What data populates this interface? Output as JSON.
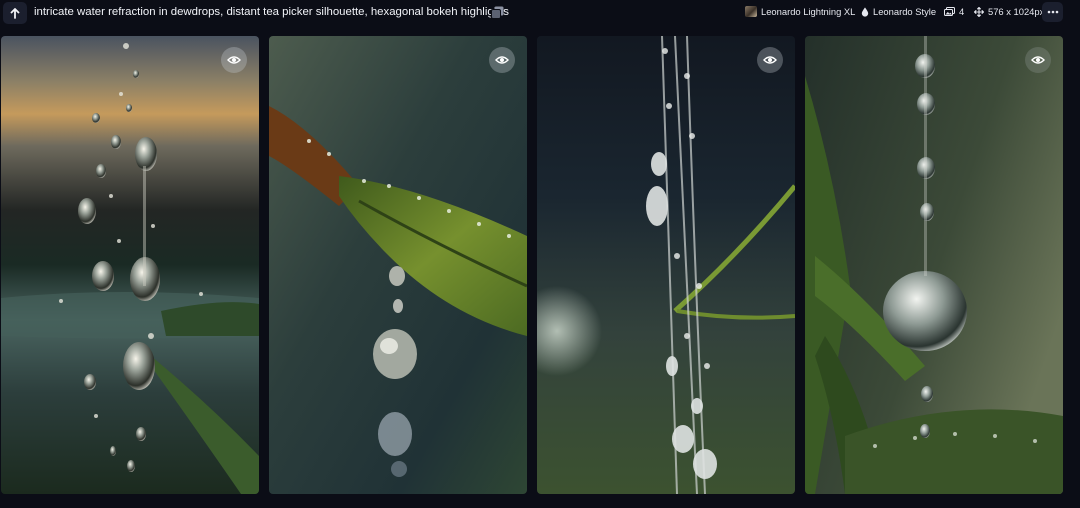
{
  "header": {
    "prompt": "intricate water refraction in dewdrops, distant tea picker silhouette, hexagonal bokeh highlights",
    "model": "Leonardo Lightning XL",
    "style": "Leonardo Style",
    "image_count": "4",
    "dimensions": "576 x 1024px"
  },
  "icons": {
    "back": "arrow-up-icon",
    "copy": "copy-icon",
    "style": "drop-icon",
    "count": "images-icon",
    "size": "resize-icon",
    "more": "more-icon",
    "view": "eye-icon"
  },
  "colors": {
    "background": "#0b0d16",
    "button": "#1b1f2e"
  }
}
